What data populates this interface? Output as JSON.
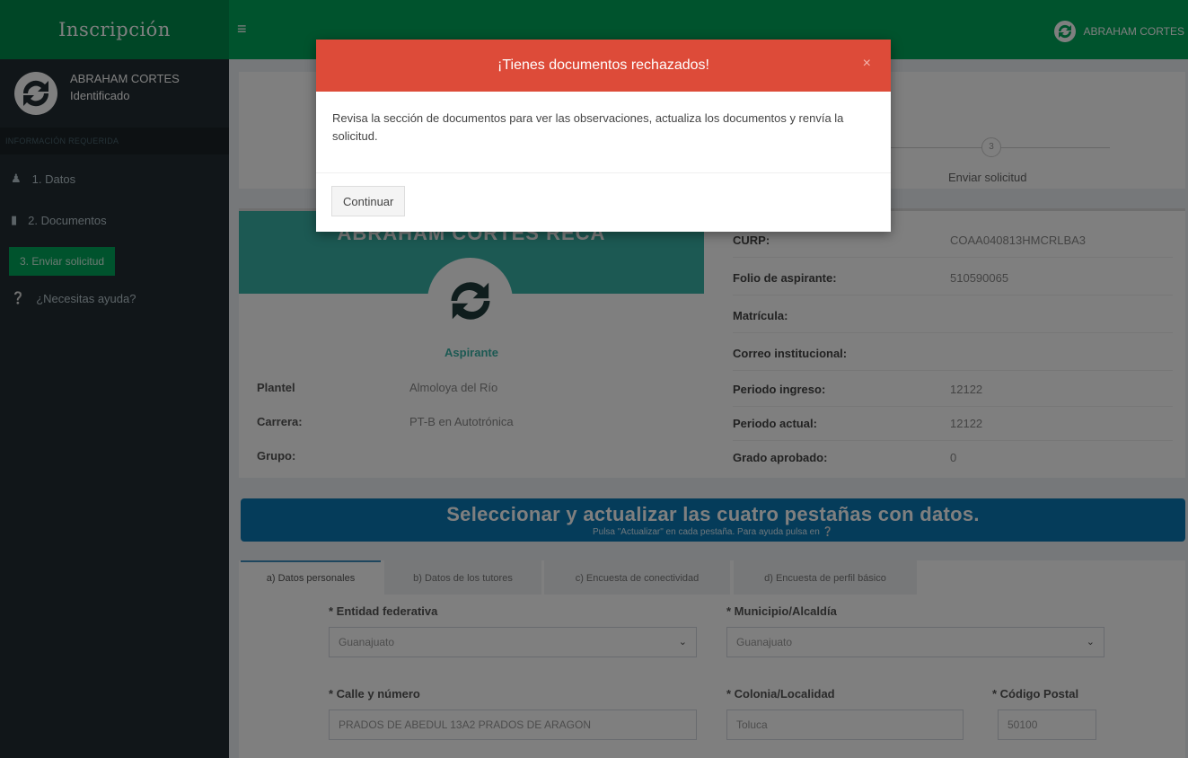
{
  "header": {
    "logo_text": "Inscripción",
    "menu_icon": "hamburger-icon",
    "user_name": "ABRAHAM CORTES"
  },
  "sidebar": {
    "user_name": "ABRAHAM CORTES",
    "user_status": "Identificado",
    "section_header": "INFORMACIÓN REQUERIDA",
    "items": [
      {
        "label": "1. Datos",
        "icon": "user-icon"
      },
      {
        "label": "2. Documentos",
        "icon": "file-icon"
      },
      {
        "label": "3. Enviar solicitud",
        "icon": ""
      },
      {
        "label": "¿Necesitas ayuda?",
        "icon": "help-circle-icon"
      }
    ]
  },
  "stepper": {
    "step3_number": "3",
    "step3_label": "Enviar solicitud"
  },
  "profile": {
    "banner_name": "ABRAHAM CORTES RECA",
    "role": "Aspirante",
    "left_fields": [
      {
        "label": "Plantel",
        "value": "Almoloya del Río"
      },
      {
        "label": "Carrera:",
        "value": "PT-B en Autotrónica"
      },
      {
        "label": "Grupo:",
        "value": ""
      }
    ],
    "right_fields": [
      {
        "label": "CURP:",
        "value": "COAA040813HMCRLBA3"
      },
      {
        "label": "Folio de aspirante:",
        "value": "510590065"
      },
      {
        "label": "Matrícula:",
        "value": ""
      },
      {
        "label": "Correo institucional:",
        "value": ""
      },
      {
        "label": "Periodo ingreso:",
        "value": "12122"
      },
      {
        "label": "Periodo actual:",
        "value": "12122"
      },
      {
        "label": "Grado aprobado:",
        "value": "0"
      }
    ]
  },
  "instructions": {
    "title": "Seleccionar y actualizar las cuatro pestañas con datos.",
    "subtitle": "Pulsa \"Actualizar\" en cada pestaña. Para ayuda pulsa en"
  },
  "tabs": [
    {
      "label": "a) Datos personales"
    },
    {
      "label": "b) Datos de los tutores"
    },
    {
      "label": "c) Encuesta de conectividad"
    },
    {
      "label": "d) Encuesta de perfil básico"
    }
  ],
  "form": {
    "entidad_label": "* Entidad federativa",
    "entidad_value": "Guanajuato",
    "municipio_label": "* Municipio/Alcaldía",
    "municipio_value": "Guanajuato",
    "calle_label": "* Calle y número",
    "calle_value": "PRADOS DE ABEDUL 13A2 PRADOS DE ARAGON",
    "colonia_label": "* Colonia/Localidad",
    "colonia_value": "Toluca",
    "cp_label": "* Código Postal",
    "cp_value": "50100"
  },
  "modal": {
    "title": "¡Tienes documentos rechazados!",
    "close": "×",
    "body": "Revisa la sección de documentos para ver las observaciones, actualiza los documentos y renvía la solicitud.",
    "button": "Continuar"
  },
  "colors": {
    "header_green": "#00a65a",
    "sidebar_dark": "#222d32",
    "modal_red": "#dd4b39",
    "banner_blue": "#0b79b4",
    "profile_teal": "#39b3a7"
  }
}
